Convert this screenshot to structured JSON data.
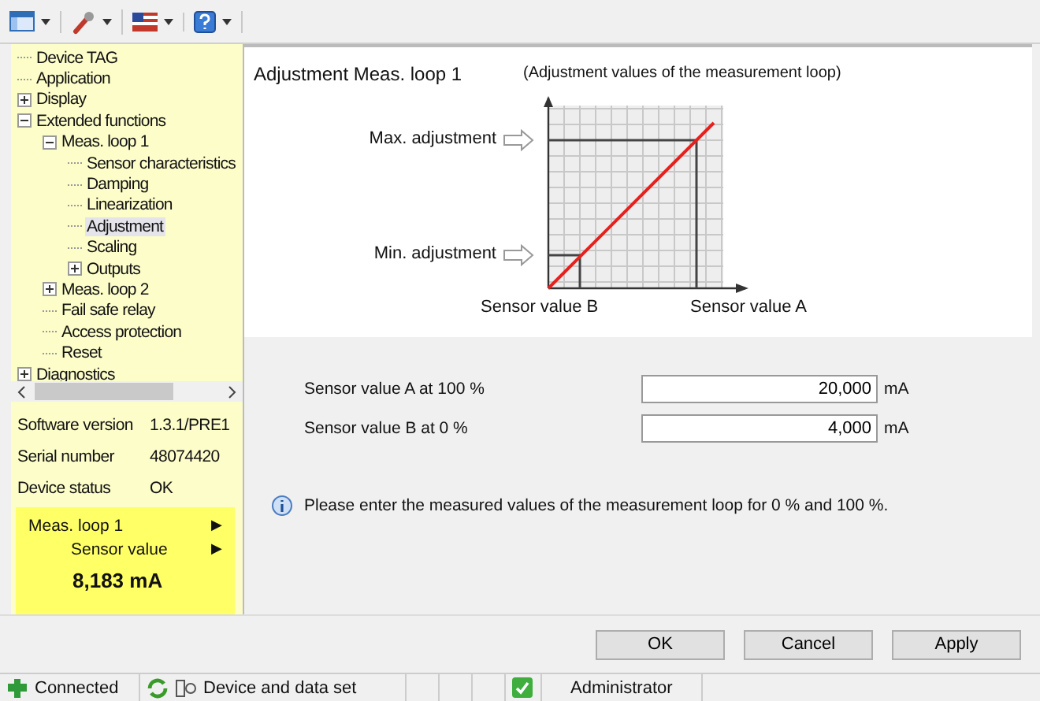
{
  "toolbar": {
    "buttons": [
      {
        "kind": "window"
      },
      {
        "kind": "wrench"
      },
      {
        "kind": "flag"
      },
      {
        "kind": "help"
      }
    ]
  },
  "tree": [
    {
      "label": "Device TAG",
      "selected": false
    },
    {
      "label": "Application",
      "selected": false
    },
    {
      "label": "Display",
      "selected": false,
      "expanded": false
    },
    {
      "label": "Extended functions",
      "selected": false,
      "expanded": true,
      "children": [
        {
          "label": "Meas. loop 1",
          "selected": false,
          "expanded": true,
          "children": [
            {
              "label": "Sensor characteristics",
              "selected": false
            },
            {
              "label": "Damping",
              "selected": false
            },
            {
              "label": "Linearization",
              "selected": false
            },
            {
              "label": "Adjustment",
              "selected": true
            },
            {
              "label": "Scaling",
              "selected": false
            },
            {
              "label": "Outputs",
              "selected": false,
              "expanded": false
            }
          ]
        },
        {
          "label": "Meas. loop 2",
          "selected": false,
          "expanded": false
        },
        {
          "label": "Fail safe relay",
          "selected": false
        },
        {
          "label": "Access protection",
          "selected": false
        },
        {
          "label": "Reset",
          "selected": false
        }
      ]
    },
    {
      "label": "Diagnostics",
      "selected": false,
      "expanded": false
    }
  ],
  "device_info": [
    {
      "label": "Software version",
      "value": "1.3.1/PRE1"
    },
    {
      "label": "Serial number",
      "value": "48074420"
    },
    {
      "label": "Device status",
      "value": "OK"
    }
  ],
  "live_value": {
    "loop": "Meas. loop 1",
    "arrow": "▶",
    "measure": "Sensor value",
    "measure_arrow": "▶",
    "value": "8,183 mA"
  },
  "page": {
    "title": "Adjustment Meas. loop 1",
    "subtitle": "(Adjustment values of the measurement loop)",
    "diagram": {
      "max_label": "Max. adjustment",
      "min_label": "Min. adjustment",
      "x_label_b": "Sensor value B",
      "x_label_a": "Sensor value A"
    },
    "fields": [
      {
        "label": "Sensor value A at 100 %",
        "value": "20,000",
        "unit": "mA"
      },
      {
        "label": "Sensor value B at 0 %",
        "value": "4,000",
        "unit": "mA"
      }
    ],
    "info": "Please enter the measured values of the measurement loop for 0 % and 100 %."
  },
  "buttons": [
    "OK",
    "Cancel",
    "Apply"
  ],
  "status_bar": {
    "connection": "Connected",
    "dataset": "Device and data set",
    "user": "Administrator"
  }
}
